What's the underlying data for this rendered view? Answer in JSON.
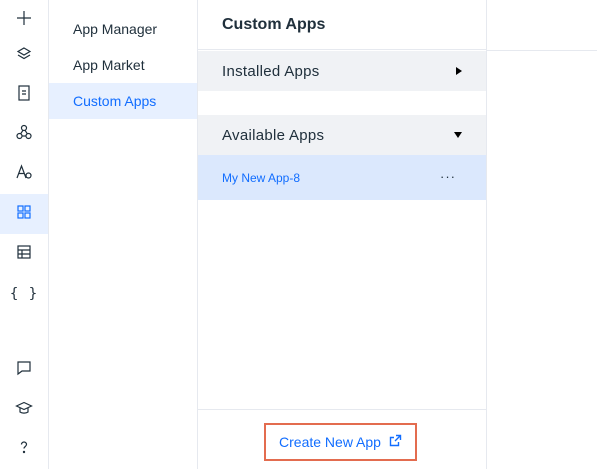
{
  "rail": {
    "items": [
      {
        "icon": "plus-icon"
      },
      {
        "icon": "layers-icon"
      },
      {
        "icon": "page-icon"
      },
      {
        "icon": "connections-icon"
      },
      {
        "icon": "fonts-icon"
      },
      {
        "icon": "apps-grid-icon",
        "active": true
      },
      {
        "icon": "table-icon"
      },
      {
        "icon": "code-braces-icon",
        "text": "{ }"
      },
      {
        "icon": "chat-icon"
      },
      {
        "icon": "learn-hat-icon"
      },
      {
        "icon": "help-icon"
      }
    ]
  },
  "subnav": {
    "items": [
      {
        "label": "App Manager"
      },
      {
        "label": "App Market"
      },
      {
        "label": "Custom Apps",
        "active": true
      }
    ]
  },
  "panel": {
    "title": "Custom Apps",
    "sections": [
      {
        "label": "Installed Apps",
        "state": "collapsed"
      },
      {
        "label": "Available Apps",
        "state": "expanded"
      }
    ],
    "apps": [
      {
        "name": "My New App-8",
        "more": "···"
      }
    ],
    "create_button": {
      "label": "Create New App",
      "icon": "external-link-icon"
    }
  },
  "colors": {
    "accent": "#116dff",
    "active_bg": "#e7f0ff",
    "section_bg": "#f0f2f5",
    "highlight_border": "#e36c4f"
  }
}
